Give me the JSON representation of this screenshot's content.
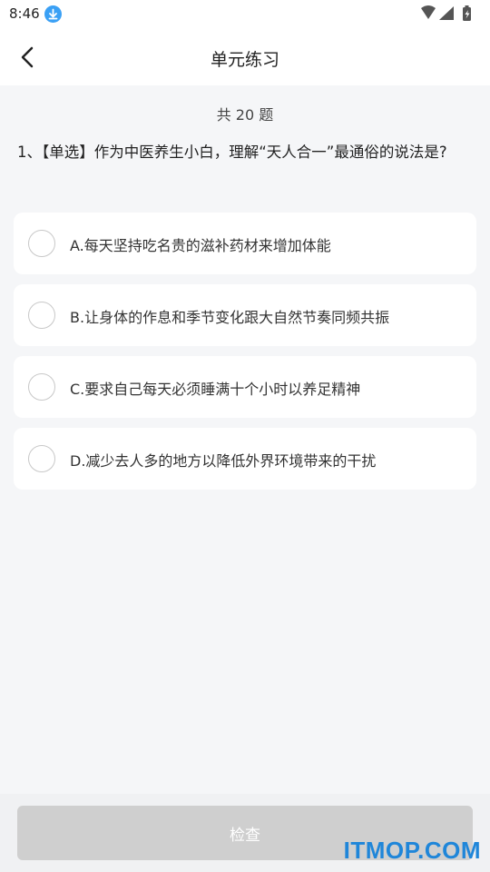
{
  "status": {
    "time": "8:46"
  },
  "header": {
    "title": "单元练习"
  },
  "quiz": {
    "count": "共 20 题",
    "question": "1、【单选】作为中医养生小白，理解“天人合一”最通俗的说法是?",
    "options": [
      {
        "label": "A.每天坚持吃名贵的滋补药材来增加体能"
      },
      {
        "label": "B.让身体的作息和季节变化跟大自然节奏同频共振"
      },
      {
        "label": "C.要求自己每天必须睡满十个小时以养足精神"
      },
      {
        "label": "D.减少去人多的地方以降低外界环境带来的干扰"
      }
    ]
  },
  "footer": {
    "check_label": "检查"
  },
  "watermark": {
    "text": "ITMOP.COM"
  },
  "colors": {
    "accent": "#3aa0f5",
    "button_disabled": "#cfcfcf",
    "watermark": "#1f86d9"
  }
}
